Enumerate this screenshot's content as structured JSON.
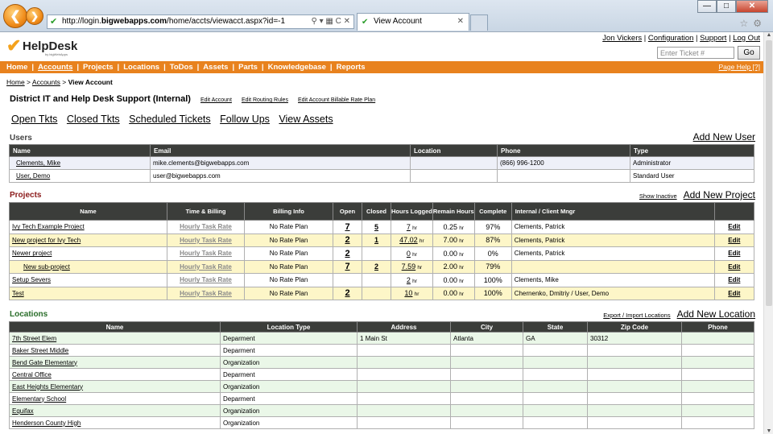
{
  "browser": {
    "url_prefix": "http://login.",
    "url_domain": "bigwebapps.com",
    "url_path": "/home/accts/viewacct.aspx?id=-1",
    "tab_title": "View Account"
  },
  "header": {
    "logo_text": "HelpDesk",
    "logo_sub": "by bigWebApps",
    "user_link": "Jon Vickers",
    "config_link": "Configuration",
    "support_link": "Support",
    "logout_link": "Log Out",
    "ticket_placeholder": "Enter Ticket #",
    "go_label": "Go"
  },
  "nav": {
    "items": [
      "Home",
      "Accounts",
      "Projects",
      "Locations",
      "ToDos",
      "Assets",
      "Parts",
      "Knowledgebase",
      "Reports"
    ],
    "page_help": "Page Help [?]"
  },
  "breadcrumb": {
    "home": "Home",
    "accounts": "Accounts",
    "current": "View Account"
  },
  "account": {
    "title": "District IT and Help Desk Support (Internal)",
    "edit_account": "Edit Account",
    "edit_routing": "Edit Routing Rules",
    "edit_billable": "Edit Account Billable Rate Plan"
  },
  "tabs": [
    "Open Tkts",
    "Closed Tkts",
    "Scheduled Tickets",
    "Follow Ups",
    "View Assets"
  ],
  "users": {
    "heading": "Users",
    "add_link": "Add New User",
    "columns": [
      "Name",
      "Email",
      "Location",
      "Phone",
      "Type"
    ],
    "rows": [
      {
        "name": "Clements, Mike",
        "email": "mike.clements@bigwebapps.com",
        "location": "",
        "phone": "(866) 996-1200",
        "type": "Administrator"
      },
      {
        "name": "User, Demo",
        "email": "user@bigwebapps.com",
        "location": "",
        "phone": "",
        "type": "Standard User"
      }
    ]
  },
  "projects": {
    "heading": "Projects",
    "show_inactive": "Show Inactive",
    "add_link": "Add New Project",
    "columns": [
      "Name",
      "Time & Billing",
      "Billing Info",
      "Open",
      "Closed",
      "Hours Logged",
      "Remain Hours",
      "Complete",
      "Internal / Client Mngr",
      ""
    ],
    "hr_unit": "hr",
    "edit_label": "Edit",
    "rows": [
      {
        "name": "Ivy Tech Example Project",
        "billing": "Hourly Task Rate",
        "info": "No Rate Plan",
        "open": "7",
        "closed": "5",
        "logged": "7",
        "remain": "0.25",
        "complete": "97%",
        "mngr": "Clements, Patrick"
      },
      {
        "name": "New project for Ivy Tech",
        "billing": "Hourly Task Rate",
        "info": "No Rate Plan",
        "open": "2",
        "closed": "1",
        "logged": "47.02",
        "remain": "7.00",
        "complete": "87%",
        "mngr": "Clements, Patrick"
      },
      {
        "name": "Newer project",
        "billing": "Hourly Task Rate",
        "info": "No Rate Plan",
        "open": "2",
        "closed": "",
        "logged": "0",
        "remain": "0.00",
        "complete": "0%",
        "mngr": "Clements, Patrick"
      },
      {
        "name": "New sub-project",
        "billing": "Hourly Task Rate",
        "info": "No Rate Plan",
        "open": "7",
        "closed": "2",
        "logged": "7.59",
        "remain": "2.00",
        "complete": "79%",
        "mngr": ""
      },
      {
        "name": "Setup Severs",
        "billing": "Hourly Task Rate",
        "info": "No Rate Plan",
        "open": "",
        "closed": "",
        "logged": "2",
        "remain": "0.00",
        "complete": "100%",
        "mngr": "Clements, Mike"
      },
      {
        "name": "Test",
        "billing": "Hourly Task Rate",
        "info": "No Rate Plan",
        "open": "2",
        "closed": "",
        "logged": "10",
        "remain": "0.00",
        "complete": "100%",
        "mngr": "Chernenko, Dmitriy / User, Demo"
      }
    ]
  },
  "locations": {
    "heading": "Locations",
    "export_link": "Export / Import Locations",
    "add_link": "Add New Location",
    "columns": [
      "Name",
      "Location Type",
      "Address",
      "City",
      "State",
      "Zip Code",
      "Phone"
    ],
    "rows": [
      {
        "name": "7th Street Elem",
        "type": "Deparment",
        "address": "1 Main St",
        "city": "Atlanta",
        "state": "GA",
        "zip": "30312",
        "phone": ""
      },
      {
        "name": "Baker Street Middle",
        "type": "Deparment",
        "address": "",
        "city": "",
        "state": "",
        "zip": "",
        "phone": ""
      },
      {
        "name": "Bend Gate Elementary",
        "type": "Organization",
        "address": "",
        "city": "",
        "state": "",
        "zip": "",
        "phone": ""
      },
      {
        "name": "Central Office",
        "type": "Deparment",
        "address": "",
        "city": "",
        "state": "",
        "zip": "",
        "phone": ""
      },
      {
        "name": "East Heights Elementary",
        "type": "Organization",
        "address": "",
        "city": "",
        "state": "",
        "zip": "",
        "phone": ""
      },
      {
        "name": "Elementary School",
        "type": "Deparment",
        "address": "",
        "city": "",
        "state": "",
        "zip": "",
        "phone": ""
      },
      {
        "name": "Equifax",
        "type": "Organization",
        "address": "",
        "city": "",
        "state": "",
        "zip": "",
        "phone": ""
      },
      {
        "name": "Henderson County High",
        "type": "Organization",
        "address": "",
        "city": "",
        "state": "",
        "zip": "",
        "phone": ""
      }
    ]
  },
  "colors": {
    "nav_orange": "#e8821e",
    "header_dark": "#3b3d3a",
    "project_alt": "#fdf6c8",
    "location_alt": "#eaf7e8"
  }
}
